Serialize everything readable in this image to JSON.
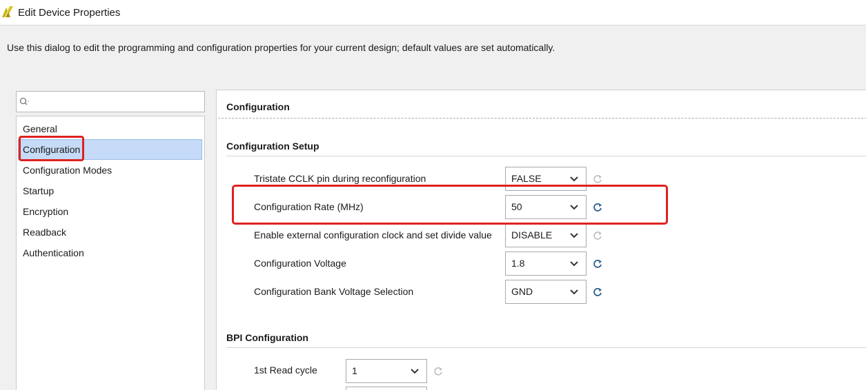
{
  "window": {
    "title": "Edit Device Properties",
    "logo_icon": "xilinx-logo-icon"
  },
  "instruction": "Use this dialog to edit the programming and configuration properties for your current design; default values are set automatically.",
  "search": {
    "placeholder": "",
    "icon": "search-icon"
  },
  "nav": {
    "items": [
      {
        "label": "General",
        "selected": false
      },
      {
        "label": "Configuration",
        "selected": true
      },
      {
        "label": "Configuration Modes",
        "selected": false
      },
      {
        "label": "Startup",
        "selected": false
      },
      {
        "label": "Encryption",
        "selected": false
      },
      {
        "label": "Readback",
        "selected": false
      },
      {
        "label": "Authentication",
        "selected": false
      }
    ]
  },
  "content": {
    "section_title": "Configuration",
    "setup": {
      "title": "Configuration Setup",
      "properties": [
        {
          "label": "Tristate CCLK pin during reconfiguration",
          "value": "FALSE",
          "reset_enabled": false
        },
        {
          "label": "Configuration Rate (MHz)",
          "value": "50",
          "reset_enabled": true
        },
        {
          "label": "Enable external configuration clock and set divide value",
          "value": "DISABLE",
          "reset_enabled": false
        },
        {
          "label": "Configuration Voltage",
          "value": "1.8",
          "reset_enabled": true
        },
        {
          "label": "Configuration Bank Voltage Selection",
          "value": "GND",
          "reset_enabled": true
        }
      ]
    },
    "bpi": {
      "title": "BPI Configuration",
      "properties": [
        {
          "label": "1st Read cycle",
          "value": "1",
          "reset_enabled": false
        }
      ]
    }
  },
  "colors": {
    "selection": "#c5dbf7",
    "highlight": "#e02020",
    "reset_active": "#2a5d8f",
    "reset_inactive": "#bdbdbd"
  }
}
